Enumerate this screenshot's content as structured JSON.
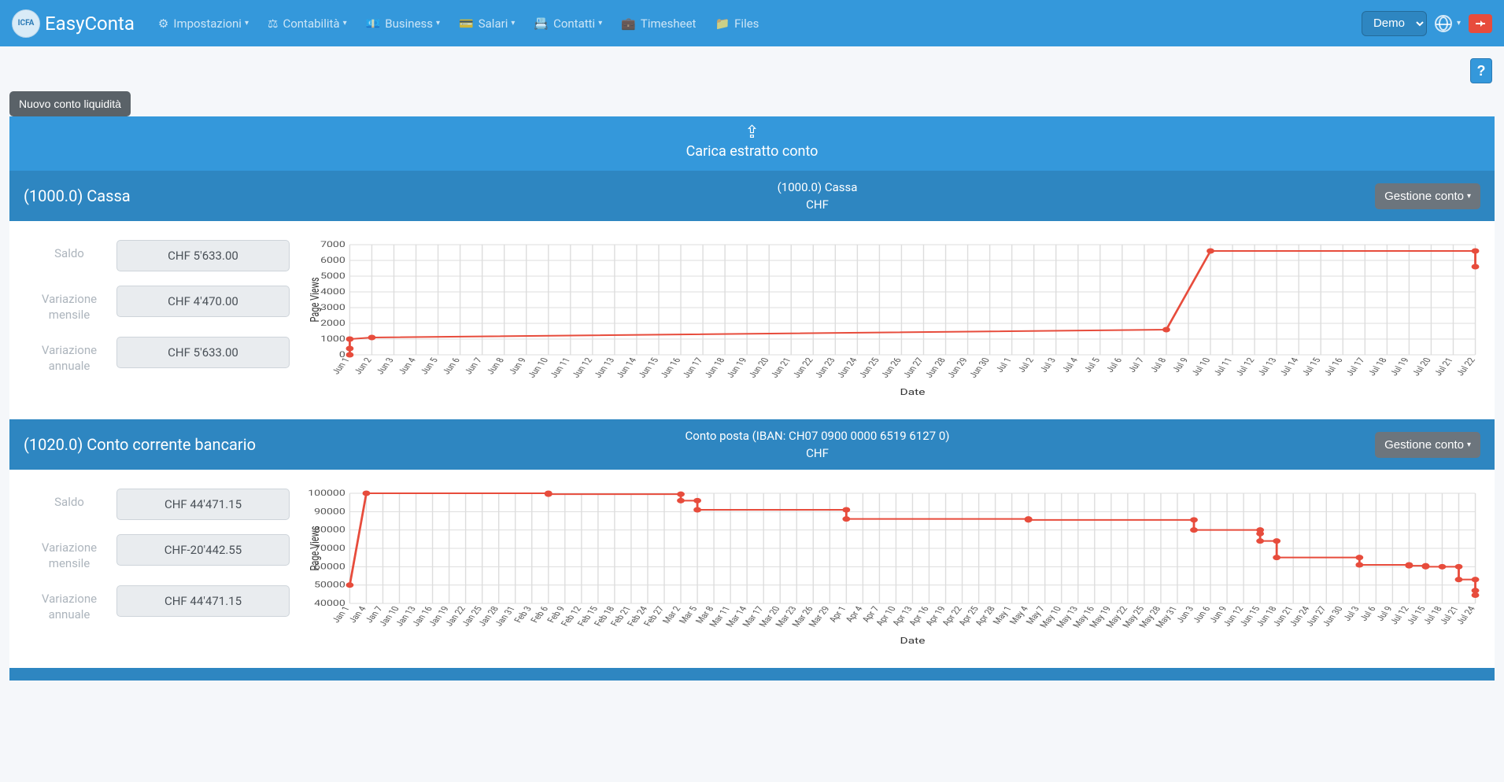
{
  "brand": {
    "logo_text": "ICFA",
    "name": "EasyConta"
  },
  "nav": {
    "impostazioni": "Impostazioni",
    "contabilita": "Contabilità",
    "business": "Business",
    "salari": "Salari",
    "contatti": "Contatti",
    "timesheet": "Timesheet",
    "files": "Files"
  },
  "demo_select": "Demo",
  "help": "?",
  "nuovo_conto": "Nuovo conto liquidità",
  "upload_label": "Carica estratto conto",
  "gestione_conto": "Gestione conto",
  "labels": {
    "saldo": "Saldo",
    "var_mensile": "Variazione mensile",
    "var_annuale": "Variazione annuale"
  },
  "accounts": [
    {
      "name": "(1000.0) Cassa",
      "center_top": "(1000.0) Cassa",
      "center_sub": "CHF",
      "saldo": "CHF 5'633.00",
      "var_mensile": "CHF 4'470.00",
      "var_annuale": "CHF 5'633.00"
    },
    {
      "name": "(1020.0) Conto corrente bancario",
      "center_top": "Conto posta (IBAN: CH07 0900 0000 6519 6127 0)",
      "center_sub": "CHF",
      "saldo": "CHF 44'471.15",
      "var_mensile": "CHF-20'442.55",
      "var_annuale": "CHF 44'471.15"
    }
  ],
  "chart_data": [
    {
      "type": "line",
      "title": "",
      "ylabel": "Page Views",
      "xlabel": "Date",
      "ylim": [
        0,
        7000
      ],
      "yticks": [
        0,
        1000,
        2000,
        3000,
        4000,
        5000,
        6000,
        7000
      ],
      "categories": [
        "Jun 1",
        "Jun 2",
        "Jun 3",
        "Jun 4",
        "Jun 5",
        "Jun 6",
        "Jun 7",
        "Jun 8",
        "Jun 9",
        "Jun 10",
        "Jun 11",
        "Jun 12",
        "Jun 13",
        "Jun 14",
        "Jun 15",
        "Jun 16",
        "Jun 17",
        "Jun 18",
        "Jun 19",
        "Jun 20",
        "Jun 21",
        "Jun 22",
        "Jun 23",
        "Jun 24",
        "Jun 25",
        "Jun 26",
        "Jun 27",
        "Jun 28",
        "Jun 29",
        "Jun 30",
        "Jul 1",
        "Jul 2",
        "Jul 3",
        "Jul 4",
        "Jul 5",
        "Jul 6",
        "Jul 7",
        "Jul 8",
        "Jul 9",
        "Jul 10",
        "Jul 11",
        "Jul 12",
        "Jul 13",
        "Jul 14",
        "Jul 15",
        "Jul 16",
        "Jul 17",
        "Jul 18",
        "Jul 19",
        "Jul 20",
        "Jul 21",
        "Jul 22"
      ],
      "sparse_points": [
        {
          "x": "Jun 1",
          "y": 0
        },
        {
          "x": "Jun 1",
          "y": 400
        },
        {
          "x": "Jun 1",
          "y": 1000
        },
        {
          "x": "Jun 2",
          "y": 1100
        },
        {
          "x": "Jul 8",
          "y": 1600
        },
        {
          "x": "Jul 10",
          "y": 6600
        },
        {
          "x": "Jul 22",
          "y": 6600
        },
        {
          "x": "Jul 22",
          "y": 5600
        }
      ]
    },
    {
      "type": "line",
      "title": "",
      "ylabel": "Page Views",
      "xlabel": "Date",
      "ylim": [
        40000,
        100000
      ],
      "yticks": [
        40000,
        50000,
        60000,
        70000,
        80000,
        90000,
        100000
      ],
      "categories": [
        "Jan 1",
        "Jan 4",
        "Jan 7",
        "Jan 10",
        "Jan 13",
        "Jan 16",
        "Jan 19",
        "Jan 22",
        "Jan 25",
        "Jan 28",
        "Jan 31",
        "Feb 3",
        "Feb 6",
        "Feb 9",
        "Feb 12",
        "Feb 15",
        "Feb 18",
        "Feb 21",
        "Feb 24",
        "Feb 27",
        "Mar 2",
        "Mar 5",
        "Mar 8",
        "Mar 11",
        "Mar 14",
        "Mar 17",
        "Mar 20",
        "Mar 23",
        "Mar 26",
        "Mar 29",
        "Apr 1",
        "Apr 4",
        "Apr 7",
        "Apr 10",
        "Apr 13",
        "Apr 16",
        "Apr 19",
        "Apr 22",
        "Apr 25",
        "Apr 28",
        "May 1",
        "May 4",
        "May 7",
        "May 10",
        "May 13",
        "May 16",
        "May 19",
        "May 22",
        "May 25",
        "May 28",
        "May 31",
        "Jun 3",
        "Jun 6",
        "Jun 9",
        "Jun 12",
        "Jun 15",
        "Jun 18",
        "Jun 21",
        "Jun 24",
        "Jun 27",
        "Jun 30",
        "Jul 3",
        "Jul 6",
        "Jul 9",
        "Jul 12",
        "Jul 15",
        "Jul 18",
        "Jul 21",
        "Jul 24"
      ],
      "sparse_points": [
        {
          "x": "Jan 1",
          "y": 50000
        },
        {
          "x": "Jan 4",
          "y": 100000
        },
        {
          "x": "Feb 6",
          "y": 100000
        },
        {
          "x": "Feb 6",
          "y": 99500
        },
        {
          "x": "Mar 2",
          "y": 99500
        },
        {
          "x": "Mar 2",
          "y": 96000
        },
        {
          "x": "Mar 5",
          "y": 96000
        },
        {
          "x": "Mar 5",
          "y": 91000
        },
        {
          "x": "Apr 1",
          "y": 91000
        },
        {
          "x": "Apr 1",
          "y": 86000
        },
        {
          "x": "May 4",
          "y": 86000
        },
        {
          "x": "May 4",
          "y": 85500
        },
        {
          "x": "Jun 3",
          "y": 85500
        },
        {
          "x": "Jun 3",
          "y": 80000
        },
        {
          "x": "Jun 15",
          "y": 80000
        },
        {
          "x": "Jun 15",
          "y": 78000
        },
        {
          "x": "Jun 15",
          "y": 74000
        },
        {
          "x": "Jun 18",
          "y": 74000
        },
        {
          "x": "Jun 18",
          "y": 65000
        },
        {
          "x": "Jul 3",
          "y": 65000
        },
        {
          "x": "Jul 3",
          "y": 61000
        },
        {
          "x": "Jul 12",
          "y": 61000
        },
        {
          "x": "Jul 12",
          "y": 60500
        },
        {
          "x": "Jul 15",
          "y": 60500
        },
        {
          "x": "Jul 15",
          "y": 60000
        },
        {
          "x": "Jul 18",
          "y": 60000
        },
        {
          "x": "Jul 21",
          "y": 60000
        },
        {
          "x": "Jul 21",
          "y": 53000
        },
        {
          "x": "Jul 24",
          "y": 53000
        },
        {
          "x": "Jul 24",
          "y": 47000
        },
        {
          "x": "Jul 24",
          "y": 44500
        }
      ]
    }
  ]
}
